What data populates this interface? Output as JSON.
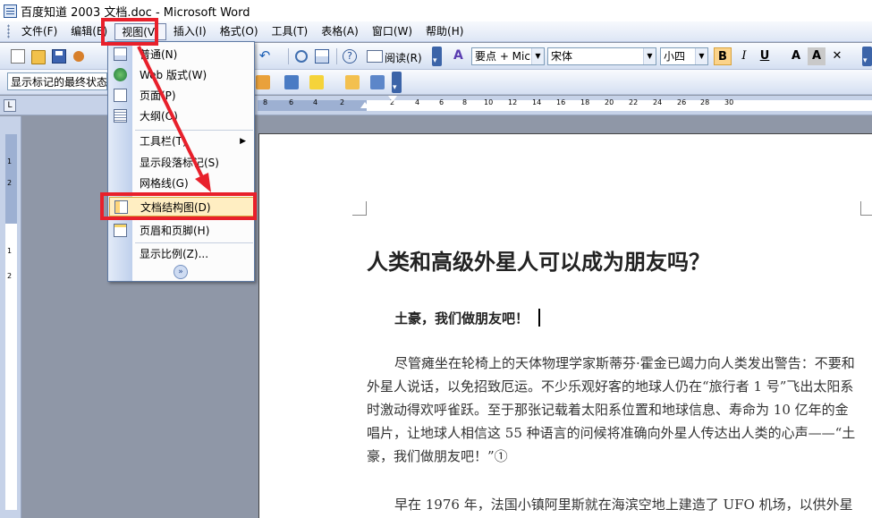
{
  "window": {
    "title": "百度知道 2003 文档.doc - Microsoft Word"
  },
  "menubar": {
    "items": [
      "文件(F)",
      "编辑(E)",
      "视图(V)",
      "插入(I)",
      "格式(O)",
      "工具(T)",
      "表格(A)",
      "窗口(W)",
      "帮助(H)"
    ],
    "active": "视图(V)"
  },
  "toolbar": {
    "reading_label": "阅读(R)",
    "style_value": "要点 + Mic",
    "font_value": "宋体",
    "size_value": "小四",
    "bold": "B",
    "italic": "I",
    "underline": "U",
    "font_color": "A",
    "markup_value": "显示标记的最终状态"
  },
  "ruler": {
    "horizontal_ticks": [
      "8",
      "6",
      "4",
      "2",
      "2",
      "4",
      "6",
      "8",
      "10",
      "12",
      "14",
      "16",
      "18",
      "20",
      "22",
      "24",
      "26",
      "28",
      "30"
    ],
    "vertical_ticks": [
      "1",
      "2",
      "1",
      "2"
    ]
  },
  "view_menu": {
    "items": [
      {
        "label": "普通(N)",
        "icon": "normal-view-icon"
      },
      {
        "label": "Web 版式(W)",
        "icon": "web-layout-icon"
      },
      {
        "label": "页面(P)",
        "icon": "print-layout-icon"
      },
      {
        "label": "大纲(O)",
        "icon": "outline-view-icon"
      },
      {
        "label": "工具栏(T)",
        "icon": "",
        "submenu": true
      },
      {
        "label": "显示段落标记(S)",
        "icon": ""
      },
      {
        "label": "网格线(G)",
        "icon": ""
      },
      {
        "label": "文档结构图(D)",
        "icon": "document-map-icon",
        "highlighted": true
      },
      {
        "label": "页眉和页脚(H)",
        "icon": "header-footer-icon"
      },
      {
        "label": "显示比例(Z)...",
        "icon": ""
      }
    ]
  },
  "document": {
    "title": "人类和高级外星人可以成为朋友吗？",
    "subhead": "土豪，我们做朋友吧！",
    "paragraph1": "尽管瘫坐在轮椅上的天体物理学家斯蒂芬·霍金已竭力向人类发出警告：不要和外星人说话，以免招致厄运。不少乐观好客的地球人仍在“旅行者 1 号”飞出太阳系时激动得欢呼雀跃。至于那张记载着太阳系位置和地球信息、寿命为 10 亿年的金唱片，让地球人相信这 55 种语言的问候将准确向外星人传达出人类的心声——“土豪，我们做朋友吧！”①",
    "paragraph2": "早在 1976 年，法国小镇阿里斯就在海滨空地上建造了 UFO 机场，以供外星"
  },
  "colors": {
    "annotation": "#e8202b",
    "menu_highlight": "#ffeec2",
    "ui_blue": "#d5e0f2"
  }
}
